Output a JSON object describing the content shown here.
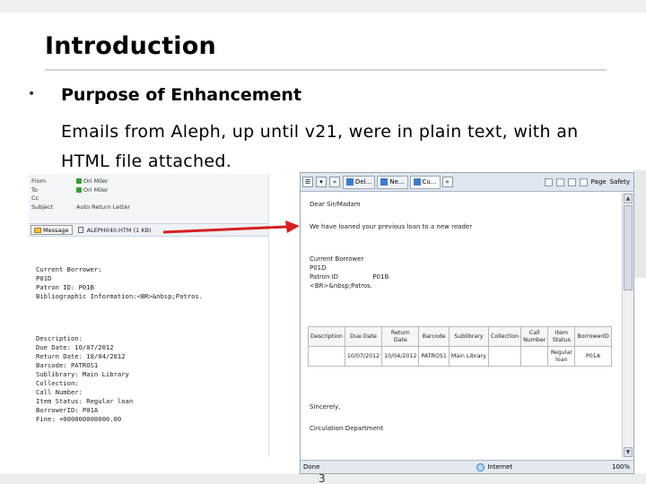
{
  "slide": {
    "title": "Introduction",
    "bullet": "•",
    "heading": "Purpose of Enhancement",
    "body": "Emails from Aleph, up until v21, were in plain text, with an HTML file attached.",
    "page_number": "3"
  },
  "plain_email": {
    "headers": [
      {
        "key": "From",
        "value": "Ori Miler",
        "verified": true
      },
      {
        "key": "To",
        "value": "Ori Miler",
        "verified": true
      },
      {
        "key": "Cc",
        "value": "",
        "verified": false
      },
      {
        "key": "Subject",
        "value": "Auto Return Letter",
        "verified": false
      }
    ],
    "message_button": "Message",
    "attachment": "ALEPH040.HTM (1 KB)",
    "lines_top": [
      "Current Borrower:",
      "P01D",
      "Patron ID: P01B",
      "Bibliographic Information:<BR>&nbsp;Patros."
    ],
    "lines_bottom": [
      "Description:",
      "Due Date: 10/07/2012",
      "Return Date: 18/04/2012",
      "Barcode: PATROS1",
      "Sublibrary: Main Library",
      "Collection:",
      "Call Number:",
      "Item Status: Regular loan",
      "BorrowerID: P01A",
      "Fine: +000000000000.00"
    ]
  },
  "html_email": {
    "tabs": [
      "Del...",
      "Ne...",
      "Cu..."
    ],
    "toolbar_right": [
      "Page",
      "Safety"
    ],
    "greeting": "Dear Sir/Madam",
    "returned_text": "We have loaned your previous loan to a new reader",
    "current_borrower": "Current Borrower",
    "borrower_name": "P01D",
    "patron_id_label": "Patron ID",
    "patron_id_value": "P01B",
    "title": "<BR>&nbsp;Patros.",
    "table_headers": [
      "Description",
      "Due Date",
      "Return Date",
      "Barcode",
      "Sublibrary",
      "Collection",
      "Call Number",
      "Item Status",
      "BorrowerID"
    ],
    "table_row": [
      "",
      "10/07/2012",
      "10/04/2012",
      "PATROS1",
      "Main Library",
      "",
      "",
      "Regular loan",
      "P01A"
    ],
    "signoff": "Sincerely,",
    "department": "Circulation Department",
    "status_done": "Done",
    "status_zone": "Internet",
    "status_zoom": "100%"
  }
}
